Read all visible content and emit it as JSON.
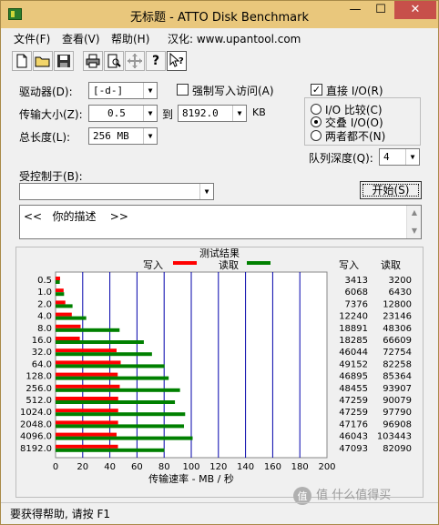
{
  "window": {
    "title": "无标题 - ATTO Disk Benchmark"
  },
  "menu": [
    "文件(F)",
    "查看(V)",
    "帮助(H)",
    "汉化: www.upantool.com"
  ],
  "toolbar_icons": [
    "new-file-icon",
    "open-folder-icon",
    "save-icon",
    "print-icon",
    "print-preview-icon",
    "move-icon",
    "help-icon",
    "context-help-icon"
  ],
  "form": {
    "drive_label": "驱动器(D):",
    "drive_value": "[-d-]",
    "transfer_label": "传输大小(Z):",
    "transfer_from": "0.5",
    "transfer_to_label": "到",
    "transfer_to": "8192.0",
    "transfer_unit": "KB",
    "total_label": "总长度(L):",
    "total_value": "256 MB",
    "force_write_label": "强制写入访问(A)",
    "force_write_checked": false,
    "direct_io_label": "直接 I/O(R)",
    "direct_io_checked": true,
    "io_compare_label": "I/O 比较(C)",
    "overlapped_io_label": "交叠 I/O(O)",
    "neither_label": "两者都不(N)",
    "selected_io": "overlapped",
    "queue_label": "队列深度(Q):",
    "queue_value": "4",
    "controlled_by_label": "受控制于(B):",
    "controlled_by_value": "",
    "start_button": "开始(S)",
    "description": "<<   你的描述    >>"
  },
  "status_text": "要获得帮助, 请按 F1",
  "watermark": "值 什么值得买",
  "chart_data": {
    "type": "bar",
    "orientation": "horizontal",
    "title": "测试结果",
    "xlabel": "传输速率 - MB / 秒",
    "xlim": [
      0,
      200
    ],
    "xticks": [
      "0",
      "20",
      "40",
      "60",
      "80",
      "100",
      "120",
      "140",
      "160",
      "180",
      "200"
    ],
    "categories": [
      "0.5",
      "1.0",
      "2.0",
      "4.0",
      "8.0",
      "16.0",
      "32.0",
      "64.0",
      "128.0",
      "256.0",
      "512.0",
      "1024.0",
      "2048.0",
      "4096.0",
      "8192.0"
    ],
    "series": [
      {
        "name": "写入",
        "color": "#ff0000",
        "values": [
          3413,
          6068,
          7376,
          12240,
          18891,
          18285,
          46044,
          49152,
          46895,
          48455,
          47259,
          47259,
          47176,
          46043,
          47093
        ]
      },
      {
        "name": "读取",
        "color": "#008000",
        "values": [
          3200,
          6430,
          12800,
          23146,
          48306,
          66609,
          72754,
          82258,
          85364,
          93907,
          90079,
          97790,
          96908,
          103443,
          82090
        ]
      }
    ],
    "value_headers": [
      "写入",
      "读取"
    ],
    "grid": true,
    "grid_color": "#0000aa",
    "legend_placement": "top"
  }
}
